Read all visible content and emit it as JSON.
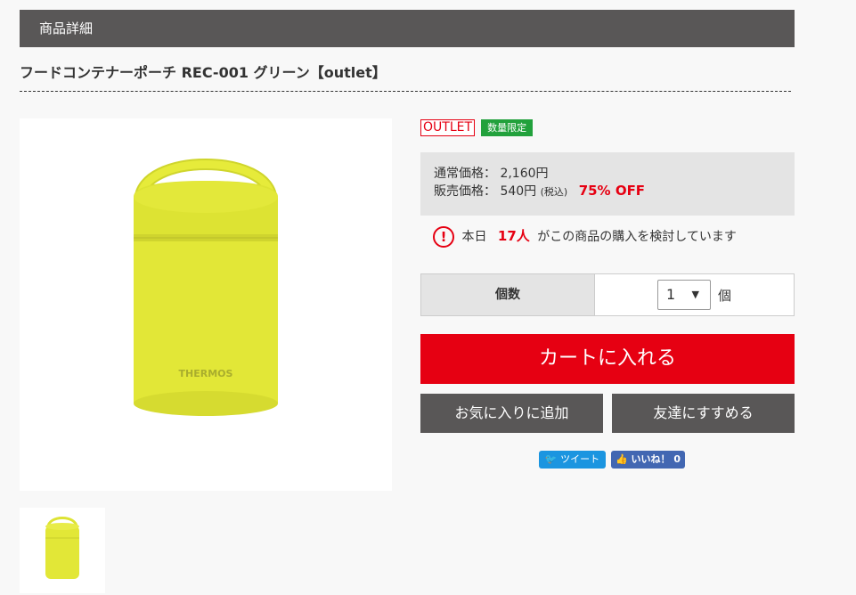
{
  "section": {
    "title": "商品詳細"
  },
  "product": {
    "title": "フードコンテナーポーチ REC-001 グリーン【outlet】",
    "brand_print": "THERMOS",
    "product_color": "#e6eb3a"
  },
  "badges": {
    "outlet": "OUTLET",
    "limited": "数量限定"
  },
  "price": {
    "regular_label": "通常価格：",
    "regular_value": "2,160円",
    "sale_label": "販売価格：",
    "sale_value": "540円",
    "tax_label": "(税込)",
    "discount": "75% OFF"
  },
  "viewers": {
    "icon": "alert-circle-icon",
    "prefix": "本日",
    "count": "17人",
    "suffix": "がこの商品の購入を検討しています"
  },
  "quantity": {
    "label": "個数",
    "value": "1",
    "unit": "個"
  },
  "actions": {
    "cart": "カートに入れる",
    "favorite": "お気に入りに追加",
    "recommend": "友達にすすめる"
  },
  "social": {
    "tweet": "ツイート",
    "like": "いいね！ 0"
  },
  "colors": {
    "accent": "#e60012",
    "dark_gray": "#595757",
    "green_badge": "#22a13c"
  }
}
